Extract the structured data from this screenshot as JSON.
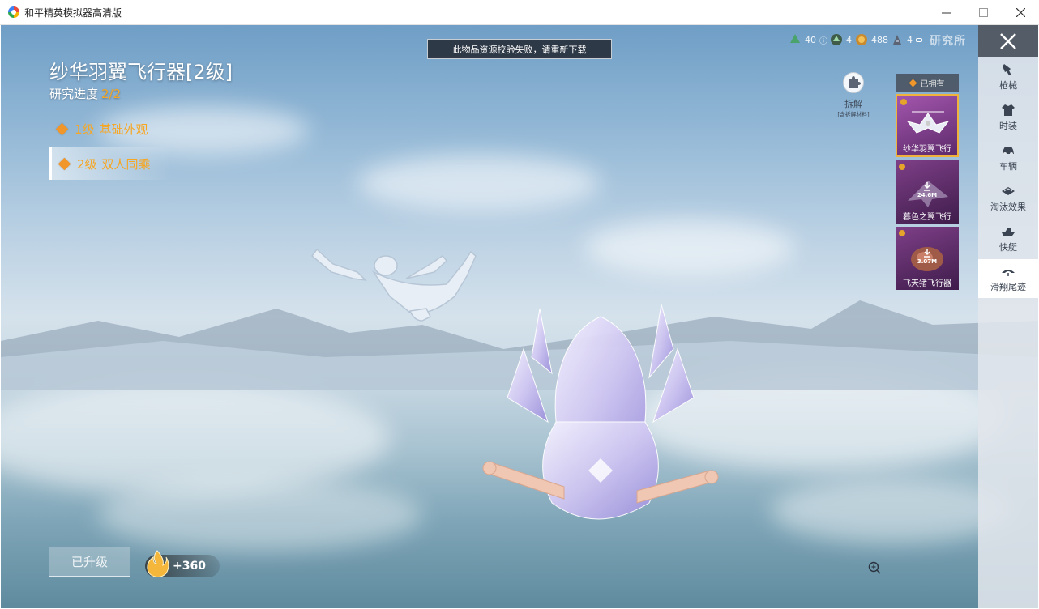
{
  "window": {
    "title": "和平精英模拟器高清版",
    "controls": {
      "minimize": "—",
      "maximize": "☐",
      "close": "✕"
    }
  },
  "toast": {
    "text": "此物品资源校验失败，请重新下载"
  },
  "item": {
    "title": "纱华羽翼飞行器[2级]",
    "progress_label": "研究进度",
    "progress_value": "2/2",
    "levels": [
      {
        "level": "1级",
        "name": "基础外观",
        "active": false
      },
      {
        "level": "2级",
        "name": "双人同乘",
        "active": true
      }
    ]
  },
  "upgrade": {
    "button_label": "已升级",
    "reward": "+360"
  },
  "currency": [
    {
      "icon": "green-coin-icon",
      "value": "40"
    },
    {
      "icon": "tree-token-icon",
      "value": "4"
    },
    {
      "icon": "gold-coin-icon",
      "value": "488"
    },
    {
      "icon": "chip-token-icon",
      "value": "4"
    }
  ],
  "research_label": "研究所",
  "decompose": {
    "label": "拆解",
    "sub": "[含拆解材料]"
  },
  "owned": {
    "header": "已拥有",
    "cards": [
      {
        "name": "纱华羽翼飞行",
        "selected": true,
        "download": ""
      },
      {
        "name": "暮色之翼飞行",
        "selected": false,
        "download": "24.6M"
      },
      {
        "name": "飞天猪飞行器",
        "selected": false,
        "download": "3.07M"
      }
    ]
  },
  "sidebar": {
    "items": [
      {
        "label": "枪械",
        "icon": "gun-icon",
        "active": false
      },
      {
        "label": "时装",
        "icon": "outfit-icon",
        "active": false
      },
      {
        "label": "车辆",
        "icon": "car-icon",
        "active": false
      },
      {
        "label": "淘汰效果",
        "icon": "elimination-icon",
        "active": false
      },
      {
        "label": "快艇",
        "icon": "boat-icon",
        "active": false
      },
      {
        "label": "滑翔尾迹",
        "icon": "glider-trail-icon",
        "active": true
      }
    ]
  },
  "colors": {
    "accent": "#f6a623",
    "card_purple": "#7e3f87",
    "sidebar": "#e1e6ec"
  }
}
